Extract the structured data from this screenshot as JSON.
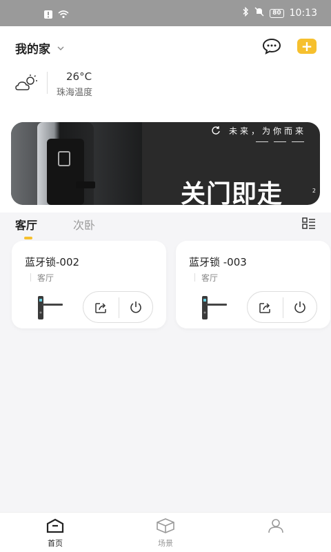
{
  "status_bar": {
    "time": "10:13",
    "battery": "80"
  },
  "header": {
    "home_name": "我的家"
  },
  "weather": {
    "temperature": "26°C",
    "location_label": "珠海温度"
  },
  "banner": {
    "slogan": "未来，为你而来",
    "headline": "关门即走",
    "page": "2"
  },
  "tabs": [
    {
      "label": "客厅"
    },
    {
      "label": "次卧"
    }
  ],
  "devices": [
    {
      "name": "蓝牙锁-002",
      "room": "客厅"
    },
    {
      "name": "蓝牙锁 -003",
      "room": "客厅"
    }
  ],
  "bottom_nav": [
    {
      "label": "首页"
    },
    {
      "label": "场景"
    }
  ],
  "colors": {
    "accent": "#f6c02e",
    "status_bar": "#9a9a9a"
  }
}
